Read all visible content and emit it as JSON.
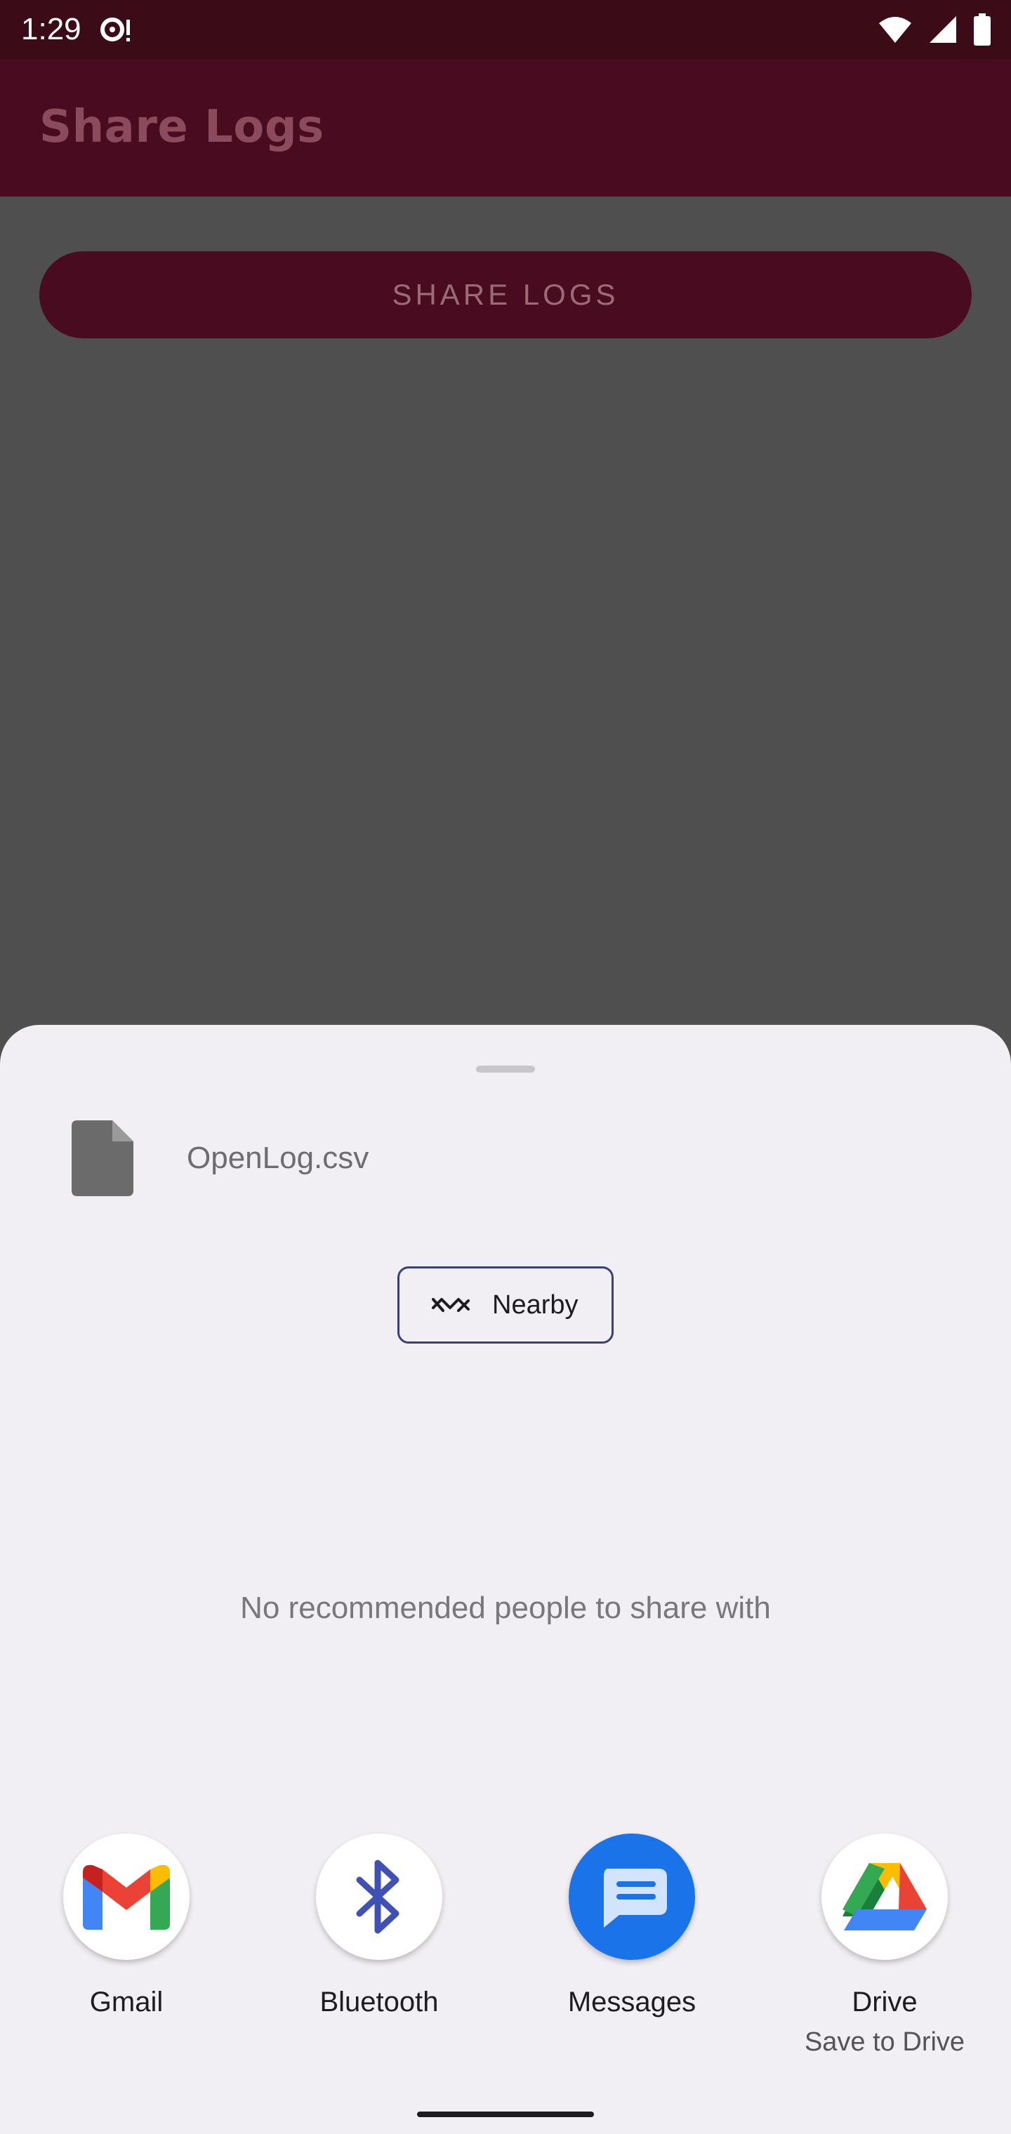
{
  "status_bar": {
    "time": "1:29",
    "icons": [
      "media-sync-icon",
      "wifi-icon",
      "signal-icon",
      "battery-icon"
    ]
  },
  "app_bar": {
    "title": "Share Logs"
  },
  "main": {
    "share_button_label": "SHARE LOGS"
  },
  "share_sheet": {
    "file_name": "OpenLog.csv",
    "nearby_label": "Nearby",
    "empty_recommendations": "No recommended people to share with",
    "targets": [
      {
        "label": "Gmail",
        "sublabel": "",
        "icon": "gmail-icon"
      },
      {
        "label": "Bluetooth",
        "sublabel": "",
        "icon": "bluetooth-icon"
      },
      {
        "label": "Messages",
        "sublabel": "",
        "icon": "messages-icon"
      },
      {
        "label": "Drive",
        "sublabel": "Save to Drive",
        "icon": "drive-icon"
      }
    ]
  },
  "colors": {
    "status_bar": "#3b0b18",
    "app_bar": "#480b20",
    "scrim": "#4f4f4f",
    "sheet": "#f2eff4",
    "nearby_border": "#3c3f7a",
    "messages_blue": "#1a73e8"
  }
}
